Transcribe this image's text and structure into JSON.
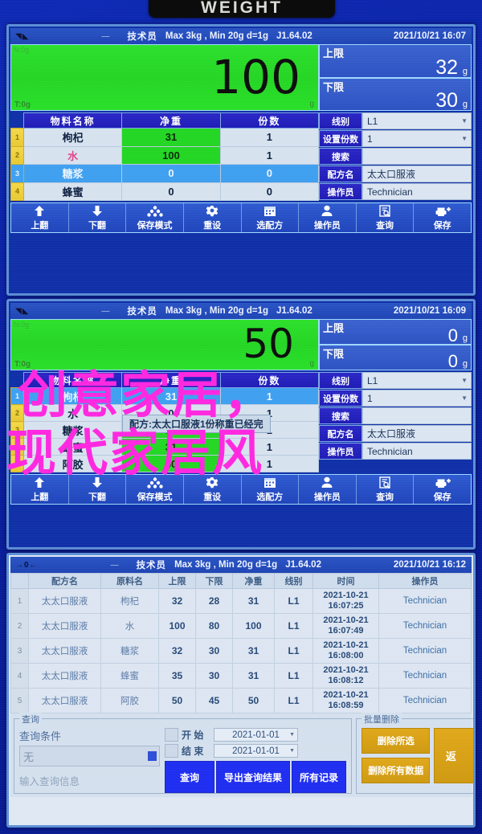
{
  "device": {
    "badge": "WEIGHT"
  },
  "statusbar": {
    "operator": "技术员",
    "spec": "Max 3kg , Min 20g  d=1g",
    "version": "J1.64.02",
    "icons": {
      "zero": "→0←",
      "stable": "◥◣"
    }
  },
  "panels": [
    {
      "id": "panel-weighing-1",
      "datetime": "2021/10/21  16:07",
      "weight": {
        "value": "100",
        "unit": "g",
        "tare": "T:0g",
        "corner_unit": "N:0g"
      },
      "limits": {
        "upper_label": "上限",
        "upper_value": "32",
        "upper_unit": "g",
        "lower_label": "下限",
        "lower_value": "30",
        "lower_unit": "g"
      },
      "table": {
        "headers": [
          "物料名称",
          "净重",
          "份数"
        ],
        "rows": [
          {
            "idx": "1",
            "name": "枸杞",
            "net": "31",
            "qty": "1",
            "net_green": true,
            "highlight": false,
            "pink": false
          },
          {
            "idx": "2",
            "name": "水",
            "net": "100",
            "qty": "1",
            "net_green": true,
            "highlight": false,
            "pink": true
          },
          {
            "idx": "3",
            "name": "糖浆",
            "net": "0",
            "qty": "0",
            "net_green": false,
            "highlight": true,
            "pink": false
          },
          {
            "idx": "4",
            "name": "蜂蜜",
            "net": "0",
            "qty": "0",
            "net_green": false,
            "highlight": false,
            "pink": false
          }
        ]
      },
      "controls": [
        {
          "key": "线别",
          "value": "L1",
          "caret": true
        },
        {
          "key": "设置份数",
          "value": "1",
          "caret": true
        },
        {
          "key": "搜索",
          "value": "",
          "caret": false
        },
        {
          "key": "配方名",
          "value": "太太口服液",
          "caret": false
        },
        {
          "key": "操作员",
          "value": "Technician",
          "caret": false
        }
      ],
      "toolbar": [
        {
          "label": "上翻",
          "icon": "arrow-up-icon"
        },
        {
          "label": "下翻",
          "icon": "arrow-down-icon"
        },
        {
          "label": "保存模式",
          "icon": "layers-icon"
        },
        {
          "label": "重设",
          "icon": "gear-icon"
        },
        {
          "label": "选配方",
          "icon": "calendar-icon"
        },
        {
          "label": "操作员",
          "icon": "user-icon"
        },
        {
          "label": "查询",
          "icon": "search-doc-icon"
        },
        {
          "label": "保存",
          "icon": "save-plus-icon"
        }
      ]
    },
    {
      "id": "panel-weighing-2",
      "datetime": "2021/10/21  16:09",
      "weight": {
        "value": "50",
        "unit": "g",
        "tare": "T:0g",
        "corner_unit": "N:0g"
      },
      "limits": {
        "upper_label": "上限",
        "upper_value": "0",
        "upper_unit": "g",
        "lower_label": "下限",
        "lower_value": "0",
        "lower_unit": "g"
      },
      "table": {
        "headers": [
          "物料名称",
          "净重",
          "份数"
        ],
        "rows": [
          {
            "idx": "1",
            "name": "枸杞",
            "net": "31",
            "qty": "1",
            "net_green": true,
            "highlight": true,
            "pink": false
          },
          {
            "idx": "2",
            "name": "水",
            "net": "100",
            "qty": "1",
            "net_green": false,
            "highlight": false,
            "pink": false
          },
          {
            "idx": "3",
            "name": "糖浆",
            "net": "31",
            "qty": "1",
            "net_green": true,
            "highlight": false,
            "pink": false
          },
          {
            "idx": "4",
            "name": "蜂蜜",
            "net": "31",
            "qty": "1",
            "net_green": true,
            "highlight": false,
            "pink": false
          },
          {
            "idx": "5",
            "name": "阿胶",
            "net": "50",
            "qty": "1",
            "net_green": true,
            "highlight": false,
            "pink": false
          }
        ]
      },
      "controls": [
        {
          "key": "线别",
          "value": "L1",
          "caret": true
        },
        {
          "key": "设置份数",
          "value": "1",
          "caret": true
        },
        {
          "key": "搜索",
          "value": "",
          "caret": false
        },
        {
          "key": "配方名",
          "value": "太太口服液",
          "caret": false
        },
        {
          "key": "操作员",
          "value": "Technician",
          "caret": false
        }
      ],
      "toolbar": [
        {
          "label": "上翻",
          "icon": "arrow-up-icon"
        },
        {
          "label": "下翻",
          "icon": "arrow-down-icon"
        },
        {
          "label": "保存模式",
          "icon": "layers-icon"
        },
        {
          "label": "重设",
          "icon": "gear-icon"
        },
        {
          "label": "选配方",
          "icon": "calendar-icon"
        },
        {
          "label": "操作员",
          "icon": "user-icon"
        },
        {
          "label": "查询",
          "icon": "search-doc-icon"
        },
        {
          "label": "保存",
          "icon": "save-plus-icon"
        }
      ],
      "toast": "配方:太太口服液1份称重已经完",
      "watermark": {
        "line1": "创意家居，",
        "line2": "现代家居风",
        "color": "#ff2ae0"
      }
    },
    {
      "id": "panel-records-3",
      "datetime": "2021/10/21  16:12",
      "records": {
        "headers": [
          "配方名",
          "原料名",
          "上限",
          "下限",
          "净重",
          "线别",
          "时间",
          "操作员"
        ],
        "rows": [
          {
            "idx": "1",
            "recipe": "太太口服液",
            "material": "枸杞",
            "upper": "32",
            "lower": "28",
            "net": "31",
            "line": "L1",
            "date": "2021-10-21",
            "time": "16:07:25",
            "operator": "Technician"
          },
          {
            "idx": "2",
            "recipe": "太太口服液",
            "material": "水",
            "upper": "100",
            "lower": "80",
            "net": "100",
            "line": "L1",
            "date": "2021-10-21",
            "time": "16:07:49",
            "operator": "Technician"
          },
          {
            "idx": "3",
            "recipe": "太太口服液",
            "material": "糖浆",
            "upper": "32",
            "lower": "30",
            "net": "31",
            "line": "L1",
            "date": "2021-10-21",
            "time": "16:08:00",
            "operator": "Technician"
          },
          {
            "idx": "4",
            "recipe": "太太口服液",
            "material": "蜂蜜",
            "upper": "35",
            "lower": "30",
            "net": "31",
            "line": "L1",
            "date": "2021-10-21",
            "time": "16:08:12",
            "operator": "Technician"
          },
          {
            "idx": "5",
            "recipe": "太太口服液",
            "material": "阿胶",
            "upper": "50",
            "lower": "45",
            "net": "50",
            "line": "L1",
            "date": "2021-10-21",
            "time": "16:08:59",
            "operator": "Technician"
          }
        ]
      },
      "query": {
        "legend": "查询",
        "condition_label": "查询条件",
        "condition_value": "无",
        "input_placeholder": "输入查询信息",
        "start_label": "开 始",
        "start_value": "2021-01-01",
        "end_label": "结 束",
        "end_value": "2021-01-01",
        "buttons": [
          "查询",
          "导出查询结果",
          "所有记录"
        ]
      },
      "batch_delete": {
        "legend": "批量删除",
        "delete_selected": "删除所选",
        "delete_all": "删除所有数据",
        "back": "返 回"
      }
    }
  ]
}
